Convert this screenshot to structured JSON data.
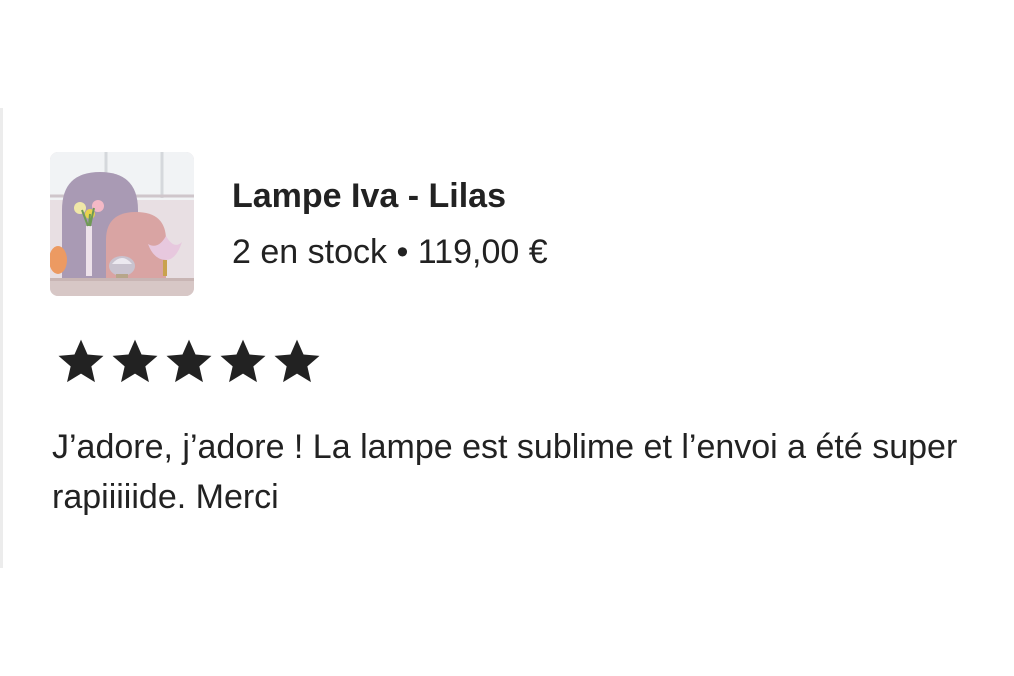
{
  "review": {
    "product": {
      "title": "Lampe Iva - Lilas",
      "stock": "2 en stock",
      "separator": "•",
      "price": "119,00 €",
      "image_icon": "product-photo"
    },
    "rating": {
      "stars": 5,
      "max": 5,
      "icon": "star-icon",
      "color": "#222222"
    },
    "text": "J’adore, j’adore ! La lampe est sublime et l’envoi a été super rapiiiiide. Merci"
  },
  "colors": {
    "text": "#222222",
    "background": "#ffffff",
    "card_edge": "#ececec"
  }
}
